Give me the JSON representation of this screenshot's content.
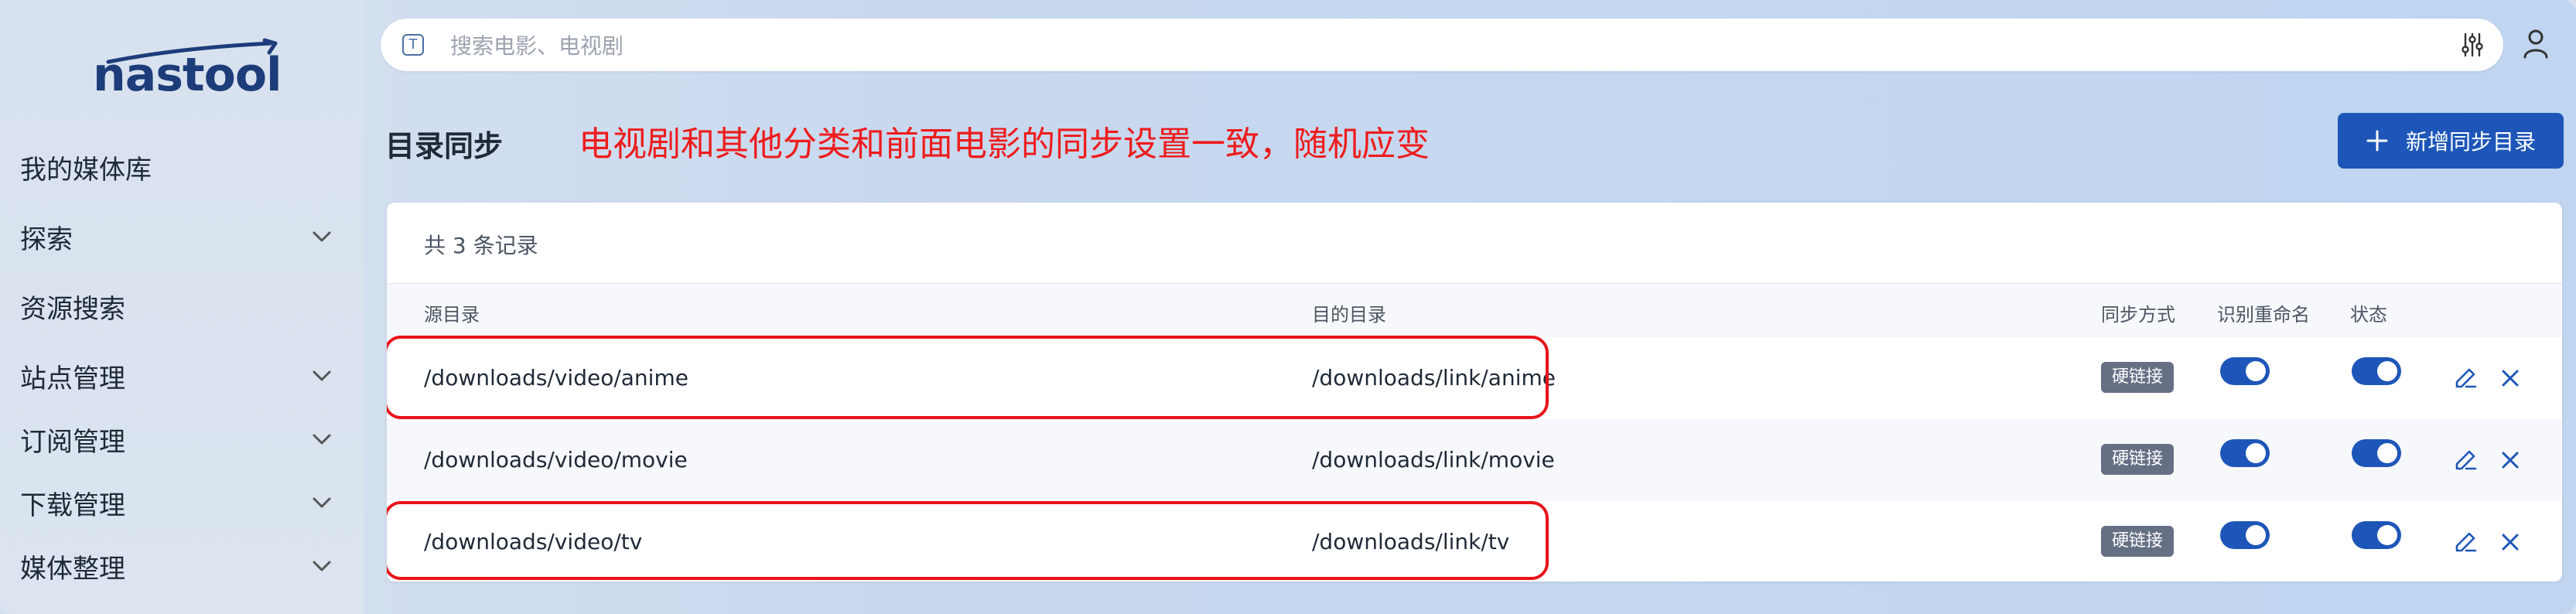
{
  "brand": {
    "logo_text": "nastool"
  },
  "sidebar": {
    "items": [
      {
        "label": "我的媒体库",
        "expandable": false
      },
      {
        "label": "探索",
        "expandable": true
      },
      {
        "label": "资源搜索",
        "expandable": false
      },
      {
        "label": "站点管理",
        "expandable": true
      },
      {
        "label": "订阅管理",
        "expandable": true
      },
      {
        "label": "下载管理",
        "expandable": true
      },
      {
        "label": "媒体整理",
        "expandable": true
      }
    ]
  },
  "search": {
    "placeholder": "搜索电影、电视剧",
    "value": "",
    "prefix_icon_letter": "T"
  },
  "page": {
    "title": "目录同步",
    "annotation": "电视剧和其他分类和前面电影的同步设置一致，随机应变",
    "add_button_label": "新增同步目录"
  },
  "table": {
    "count_text": "共 3 条记录",
    "headers": {
      "source": "源目录",
      "dest": "目的目录",
      "mode": "同步方式",
      "rename": "识别重命名",
      "status": "状态"
    },
    "rows": [
      {
        "source": "/downloads/video/anime",
        "dest": "/downloads/link/anime",
        "mode": "硬链接",
        "rename": true,
        "status": true,
        "highlighted": true
      },
      {
        "source": "/downloads/video/movie",
        "dest": "/downloads/link/movie",
        "mode": "硬链接",
        "rename": true,
        "status": true,
        "highlighted": false
      },
      {
        "source": "/downloads/video/tv",
        "dest": "/downloads/link/tv",
        "mode": "硬链接",
        "rename": true,
        "status": true,
        "highlighted": true
      }
    ]
  },
  "colors": {
    "accent": "#1d56b8",
    "annotation": "#ee1c1c",
    "badge": "#667085",
    "highlight_border": "#e8141a"
  },
  "icons": {
    "search_prefix": "text-icon",
    "filter": "sliders-icon",
    "user": "user-icon",
    "edit": "pencil-icon",
    "delete": "close-icon",
    "expand": "chevron-down-icon",
    "add": "plus-icon"
  }
}
